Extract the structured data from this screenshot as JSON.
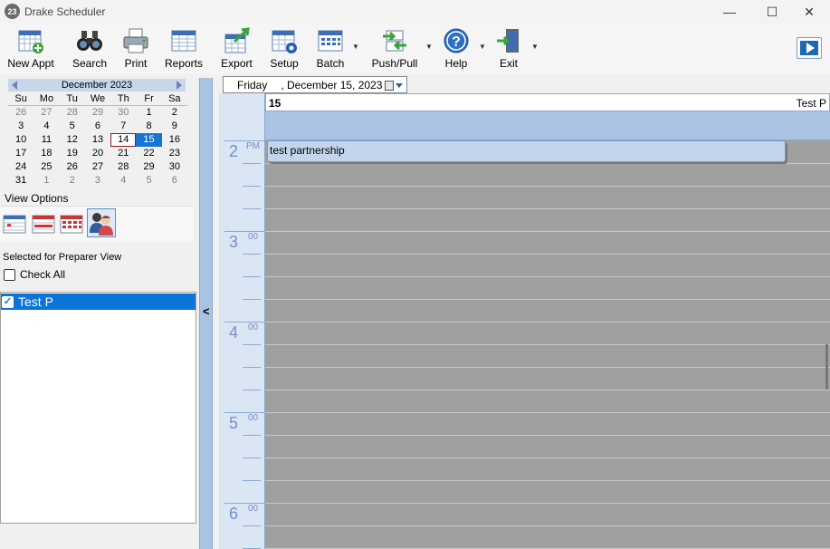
{
  "window": {
    "icon_text": "23",
    "title": "Drake Scheduler",
    "minimize": "—",
    "maximize": "☐",
    "close": "✕"
  },
  "toolbar": {
    "new_appt": "New Appt",
    "search": "Search",
    "print": "Print",
    "reports": "Reports",
    "export": "Export",
    "setup": "Setup",
    "batch": "Batch",
    "push_pull": "Push/Pull",
    "help": "Help",
    "exit": "Exit",
    "dropdown_glyph": "▼"
  },
  "calendar": {
    "month_label": "December 2023",
    "days_of_week": [
      "Su",
      "Mo",
      "Tu",
      "We",
      "Th",
      "Fr",
      "Sa"
    ],
    "weeks": [
      [
        "26",
        "27",
        "28",
        "29",
        "30",
        "1",
        "2"
      ],
      [
        "3",
        "4",
        "5",
        "6",
        "7",
        "8",
        "9"
      ],
      [
        "10",
        "11",
        "12",
        "13",
        "14",
        "15",
        "16"
      ],
      [
        "17",
        "18",
        "19",
        "20",
        "21",
        "22",
        "23"
      ],
      [
        "24",
        "25",
        "26",
        "27",
        "28",
        "29",
        "30"
      ],
      [
        "31",
        "1",
        "2",
        "3",
        "4",
        "5",
        "6"
      ]
    ],
    "today": "14",
    "selected": "15"
  },
  "view_options": {
    "label": "View Options"
  },
  "preparer": {
    "section_label": "Selected for Preparer View",
    "check_all_label": "Check All",
    "items": [
      {
        "name": "Test P",
        "checked": true
      }
    ]
  },
  "splitter": {
    "glyph": "<"
  },
  "date_picker": {
    "day": "Friday",
    "date": ", December 15, 2023"
  },
  "schedule": {
    "day_number": "15",
    "preparer_name": "Test P",
    "hours": [
      {
        "hour": "2",
        "suffix": "PM"
      },
      {
        "hour": "3",
        "suffix": "00"
      },
      {
        "hour": "4",
        "suffix": "00"
      },
      {
        "hour": "5",
        "suffix": "00"
      },
      {
        "hour": "6",
        "suffix": "00"
      }
    ],
    "appointments": [
      {
        "title": "test partnership"
      }
    ]
  },
  "colors": {
    "accent": "#1874d2",
    "selected_list_item": "#0a74d8",
    "schedule_header": "#a9c4e3",
    "grid_background": "#a0a0a0",
    "hour_text": "#6e93c7"
  }
}
